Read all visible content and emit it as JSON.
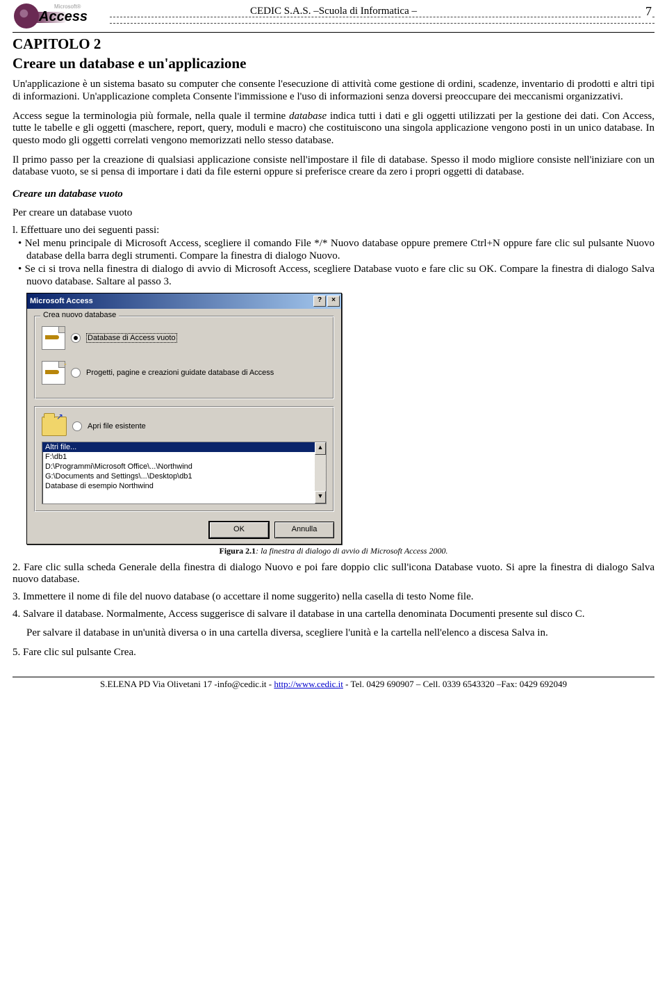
{
  "header": {
    "logo_small": "Microsoft®",
    "logo_main": "Access",
    "center": "CEDIC S.A.S. –Scuola di Informatica –",
    "page_number": "7"
  },
  "chapter": {
    "line1": "CAPITOLO 2",
    "line2": "Creare un database e un'applicazione"
  },
  "paragraphs": {
    "p1": "Un'applicazione è un sistema basato su computer che consente l'esecuzione di attività come gestione di ordini, scadenze, inventario di prodotti e altri tipi di informazioni. Un'applicazione completa Consente l'immissione e l'uso di informazioni senza doversi preoccupare dei meccanismi organizzativi.",
    "p2_a": "Access segue la terminologia più formale, nella quale il termine ",
    "p2_db": "database",
    "p2_b": " indica tutti i dati e gli oggetti utilizzati per la gestione dei dati. Con Access, tutte le tabelle e gli oggetti (maschere, report, query, moduli e macro) che costituiscono una singola applicazione vengono posti in un unico database. In questo modo gli oggetti correlati vengono memorizzati nello stesso database.",
    "p3": "Il primo passo per la creazione di qualsiasi applicazione consiste nell'impostare il file di database. Spesso il modo migliore consiste nell'iniziare con un database vuoto, se si pensa di importare i dati da file esterni oppure si preferisce creare da zero i propri oggetti di database.",
    "subhead": "Creare un database vuoto",
    "intro": "Per creare un database vuoto",
    "step1": "l. Effettuare uno dei seguenti passi:",
    "bullet1": "Nel menu principale di Microsoft Access, scegliere il comando File */* Nuovo database oppure premere Ctrl+N oppure fare clic sul pulsante Nuovo database della barra degli strumenti. Compare la finestra di dialogo Nuovo.",
    "bullet2": "Se ci si trova nella finestra di dialogo di avvio di Microsoft Access, scegliere Database vuoto e fare clic su OK. Compare la finestra di dialogo Salva nuovo database. Saltare al passo 3.",
    "caption_b": "Figura 2.1",
    "caption_i": ": la finestra di dialogo di avvio di Microsoft Access 2000.",
    "step2": "2. Fare clic sulla scheda Generale della finestra di dialogo Nuovo e poi fare doppio clic sull'icona Database vuoto. Si apre la finestra di dialogo Salva nuovo database.",
    "step3": "3. Immettere il nome di file del nuovo database (o accettare il nome suggerito) nella casella di testo Nome file.",
    "step4": "4. Salvare il database. Normalmente, Access suggerisce di salvare il database in una cartella denominata Documenti presente sul disco C.",
    "step4b": "Per salvare il database in un'unità diversa o in una cartella diversa, scegliere l'unità e la cartella nell'elenco a discesa Salva in.",
    "step5": "5. Fare clic sul pulsante Crea."
  },
  "dialog": {
    "title": "Microsoft Access",
    "help_btn": "?",
    "close_btn": "×",
    "group1": {
      "legend": "Crea nuovo database",
      "opt1": "Database di Access vuoto",
      "opt2": "Progetti, pagine e creazioni guidate database di Access"
    },
    "group2": {
      "opt": "Apri file esistente",
      "list": [
        "Altri file...",
        "F:\\db1",
        "D:\\Programmi\\Microsoft Office\\...\\Northwind",
        "G:\\Documents and Settings\\...\\Desktop\\db1",
        "Database di esempio Northwind"
      ]
    },
    "ok": "OK",
    "cancel": "Annulla"
  },
  "footer": {
    "text_a": "S.ELENA  PD  Via Olivetani 17 -info@cedic.it - ",
    "link": "http://www.cedic.it",
    "text_b": "  - Tel. 0429 690907 – Cell. 0339 6543320 –Fax: 0429 692049"
  }
}
